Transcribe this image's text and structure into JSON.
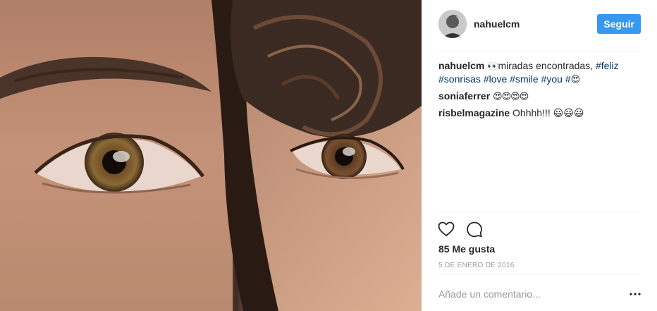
{
  "post": {
    "author": "nahuelcm",
    "follow_label": "Seguir",
    "likes_text": "85 Me gusta",
    "date_text": "5 de enero de 2016",
    "comment_placeholder": "Añade un comentario..."
  },
  "caption": {
    "user": "nahuelcm",
    "emoji_eyes": "👀",
    "text": "miradas encontradas, ",
    "tags": [
      "#feliz",
      "#sonrisas",
      "#love",
      "#smile",
      "#you",
      "#"
    ],
    "emoji_heart_eyes": "😍"
  },
  "comments": [
    {
      "user": "soniaferrer",
      "text": "😍😍😍😍"
    },
    {
      "user": "risbelmagazine",
      "text": "Ohhhh!!! 😃😃😃"
    }
  ],
  "icons": {
    "like": "heart-icon",
    "comment": "speech-bubble-icon",
    "more": "more-options-icon"
  },
  "colors": {
    "follow_button": "#3897f0",
    "hashtag": "#003569",
    "muted": "#999999"
  }
}
